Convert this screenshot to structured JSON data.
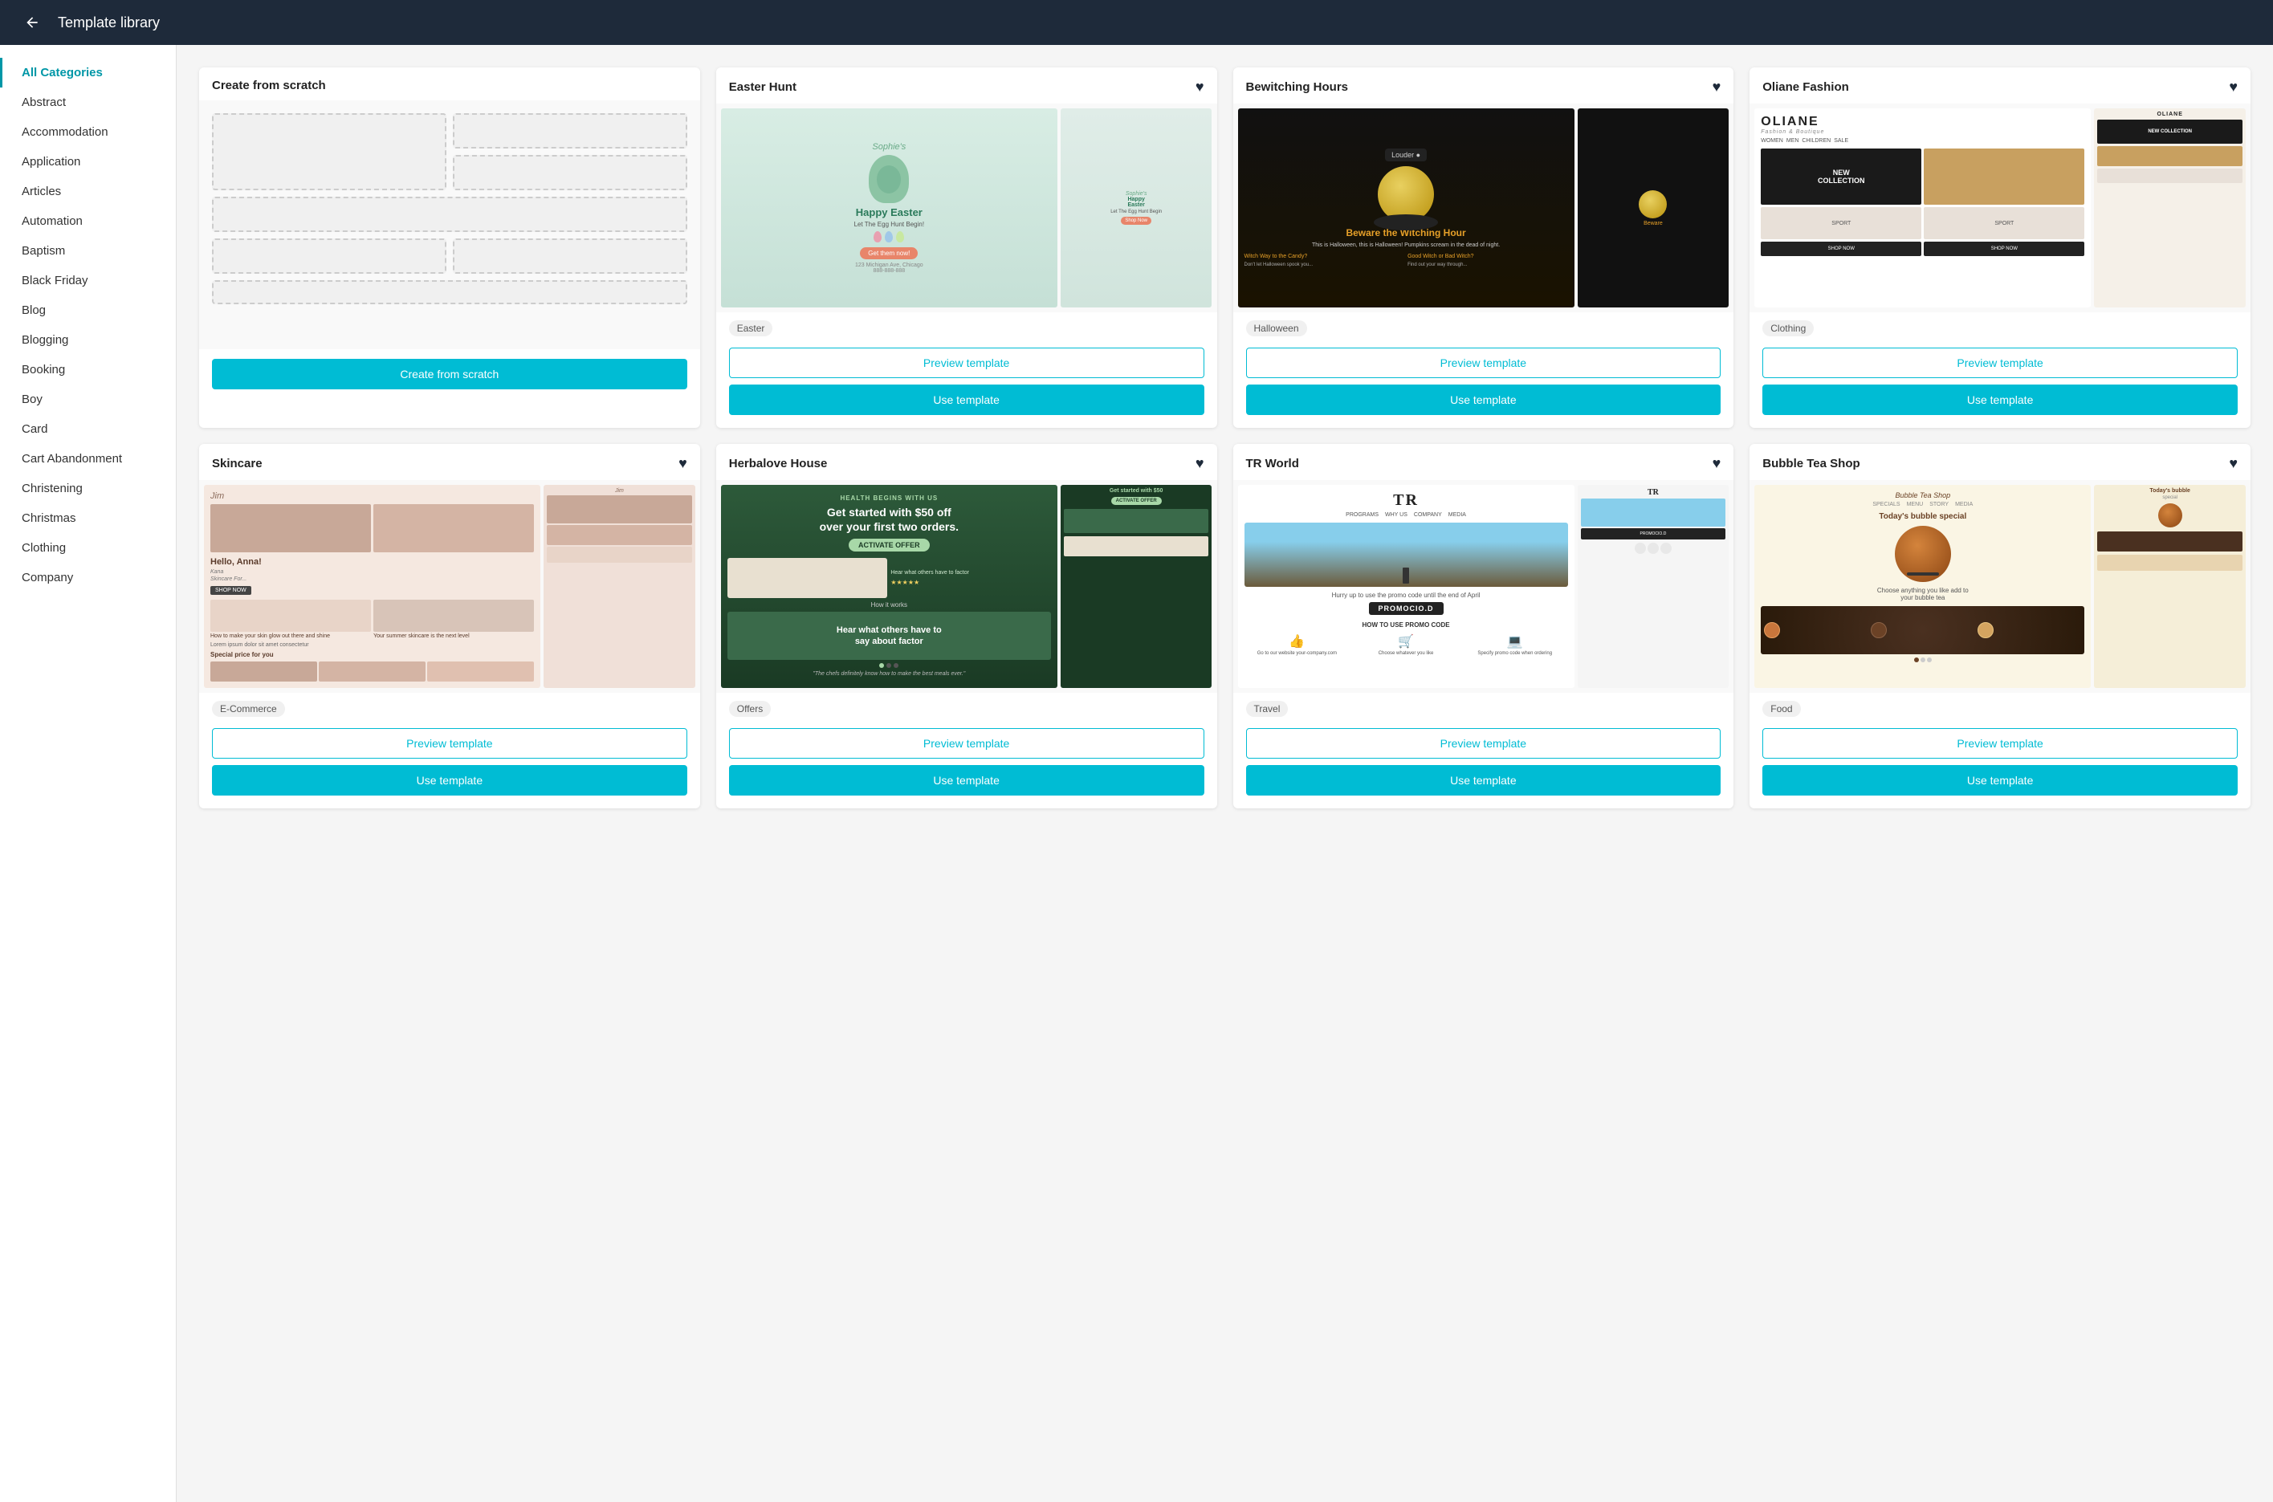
{
  "header": {
    "title": "Template library",
    "back_label": "back"
  },
  "sidebar": {
    "items": [
      {
        "label": "All Categories",
        "active": true
      },
      {
        "label": "Abstract",
        "active": false
      },
      {
        "label": "Accommodation",
        "active": false
      },
      {
        "label": "Application",
        "active": false
      },
      {
        "label": "Articles",
        "active": false
      },
      {
        "label": "Automation",
        "active": false
      },
      {
        "label": "Baptism",
        "active": false
      },
      {
        "label": "Black Friday",
        "active": false
      },
      {
        "label": "Blog",
        "active": false
      },
      {
        "label": "Blogging",
        "active": false
      },
      {
        "label": "Booking",
        "active": false
      },
      {
        "label": "Boy",
        "active": false
      },
      {
        "label": "Card",
        "active": false
      },
      {
        "label": "Cart Abandonment",
        "active": false
      },
      {
        "label": "Christening",
        "active": false
      },
      {
        "label": "Christmas",
        "active": false
      },
      {
        "label": "Clothing",
        "active": false
      },
      {
        "label": "Company",
        "active": false
      }
    ]
  },
  "templates": [
    {
      "id": "create-from-scratch",
      "title": "Create from scratch",
      "tag": null,
      "heart": false,
      "type": "scratch",
      "preview_btn_label": null,
      "action_btn_label": "Create from scratch",
      "tag_label": null,
      "bottom_tag": null
    },
    {
      "id": "easter-hunt",
      "title": "Easter Hunt",
      "heart": true,
      "type": "template",
      "tag_label": "Easter",
      "preview_btn_label": "Preview template",
      "action_btn_label": "Use template",
      "bottom_tag": null
    },
    {
      "id": "bewitching-hours",
      "title": "Bewitching Hours",
      "heart": true,
      "type": "template",
      "tag_label": "Halloween",
      "preview_btn_label": "Preview template",
      "action_btn_label": "Use template",
      "bottom_tag": null
    },
    {
      "id": "oliane-fashion",
      "title": "Oliane Fashion",
      "heart": true,
      "type": "template",
      "tag_label": "Clothing",
      "preview_btn_label": "Preview template",
      "action_btn_label": "Use template",
      "bottom_tag": null
    },
    {
      "id": "skincare",
      "title": "Skincare",
      "heart": true,
      "type": "template",
      "tag_label": "E-Commerce",
      "preview_btn_label": "Preview template",
      "action_btn_label": "Use template",
      "bottom_tag": "E-Commerce"
    },
    {
      "id": "herbalove-house",
      "title": "Herbalove House",
      "heart": true,
      "type": "template",
      "tag_label": "Offers",
      "preview_btn_label": "Preview template",
      "action_btn_label": "Use template",
      "bottom_tag": "Offers"
    },
    {
      "id": "tr-world",
      "title": "TR World",
      "heart": true,
      "type": "template",
      "tag_label": "Travel",
      "preview_btn_label": "Preview template",
      "action_btn_label": "Use template",
      "bottom_tag": "Travel"
    },
    {
      "id": "bubble-tea-shop",
      "title": "Bubble Tea Shop",
      "heart": true,
      "type": "template",
      "tag_label": "Food",
      "preview_btn_label": "Preview template",
      "action_btn_label": "Use template",
      "bottom_tag": "Food"
    }
  ],
  "colors": {
    "header_bg": "#1e2a3a",
    "accent": "#00bcd4",
    "active_sidebar": "#0097a7"
  }
}
